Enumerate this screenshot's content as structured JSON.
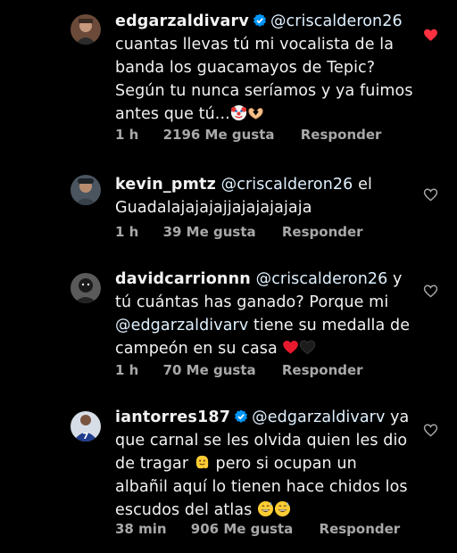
{
  "comments": [
    {
      "username": "edgarzaldivarv",
      "verified": true,
      "mention": "@criscalderon26",
      "text": "cuantas llevas tú mi vocalista de la banda los guacamayos de Tepic? Según tu nunca seríamos y ya fuimos antes que tú...",
      "time": "1 h",
      "likes": "2196 Me gusta",
      "reply": "Responder",
      "liked": true
    },
    {
      "username": "kevin_pmtz",
      "verified": false,
      "mention": "@criscalderon26",
      "text": "el Guadalajajajajjajajajajaja",
      "time": "1 h",
      "likes": "39 Me gusta",
      "reply": "Responder",
      "liked": false
    },
    {
      "username": "davidcarrionnn",
      "verified": false,
      "mention": "@criscalderon26",
      "text_1": "y tú cuántas has ganado? Porque mi",
      "mention_2": "@edgarzaldivarv",
      "text_2": "tiene su medalla de campeón en su casa",
      "time": "1 h",
      "likes": "70 Me gusta",
      "reply": "Responder",
      "liked": false
    },
    {
      "username": "iantorres187",
      "verified": true,
      "mention": "@edgarzaldivarv",
      "text_1": "ya que carnal se les olvida quien les dio de tragar",
      "text_2": "pero si ocupan un albañil aquí lo tienen hace chidos los escudos del atlas",
      "time": "38 min",
      "likes": "906 Me gusta",
      "reply": "Responder",
      "liked": false
    }
  ],
  "colors": {
    "background": "#000000",
    "text": "#f2f2f2",
    "meta": "#a8a8a8",
    "liked_heart": "#ff3040",
    "verified_badge": "#0095f6"
  }
}
